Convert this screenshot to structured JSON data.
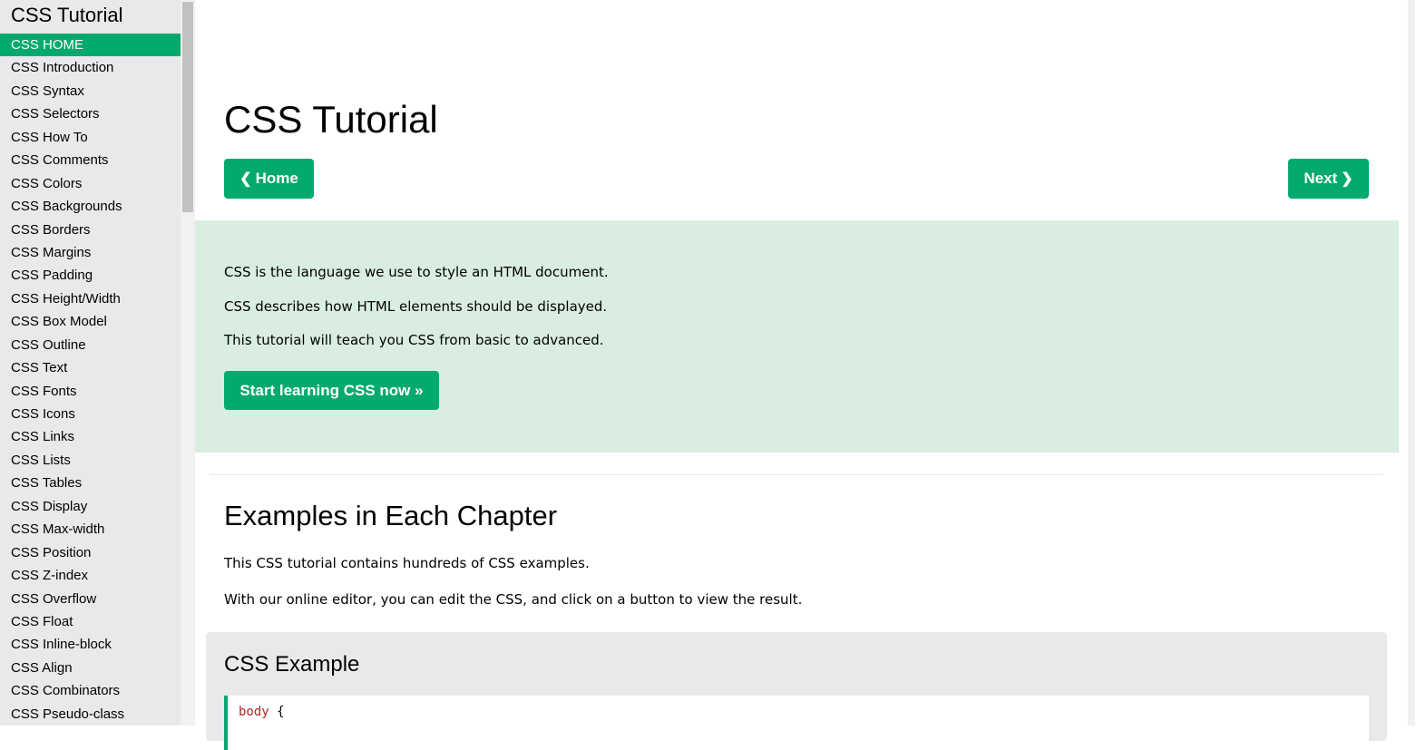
{
  "sidebar": {
    "title": "CSS Tutorial",
    "items": [
      {
        "label": "CSS HOME",
        "active": true
      },
      {
        "label": "CSS Introduction"
      },
      {
        "label": "CSS Syntax"
      },
      {
        "label": "CSS Selectors"
      },
      {
        "label": "CSS How To"
      },
      {
        "label": "CSS Comments"
      },
      {
        "label": "CSS Colors"
      },
      {
        "label": "CSS Backgrounds"
      },
      {
        "label": "CSS Borders"
      },
      {
        "label": "CSS Margins"
      },
      {
        "label": "CSS Padding"
      },
      {
        "label": "CSS Height/Width"
      },
      {
        "label": "CSS Box Model"
      },
      {
        "label": "CSS Outline"
      },
      {
        "label": "CSS Text"
      },
      {
        "label": "CSS Fonts"
      },
      {
        "label": "CSS Icons"
      },
      {
        "label": "CSS Links"
      },
      {
        "label": "CSS Lists"
      },
      {
        "label": "CSS Tables"
      },
      {
        "label": "CSS Display"
      },
      {
        "label": "CSS Max-width"
      },
      {
        "label": "CSS Position"
      },
      {
        "label": "CSS Z-index"
      },
      {
        "label": "CSS Overflow"
      },
      {
        "label": "CSS Float"
      },
      {
        "label": "CSS Inline-block"
      },
      {
        "label": "CSS Align"
      },
      {
        "label": "CSS Combinators"
      },
      {
        "label": "CSS Pseudo-class"
      }
    ]
  },
  "main": {
    "title": "CSS Tutorial",
    "nav": {
      "home_label": "Home",
      "next_label": "Next"
    },
    "intro": {
      "lines": [
        "CSS is the language we use to style an HTML document.",
        "CSS describes how HTML elements should be displayed.",
        "This tutorial will teach you CSS from basic to advanced."
      ],
      "cta_label": "Start learning CSS now »"
    },
    "examples_section": {
      "title": "Examples in Each Chapter",
      "paragraphs": [
        "This CSS tutorial contains hundreds of CSS examples.",
        "With our online editor, you can edit the CSS, and click on a button to view the result."
      ]
    },
    "example_box": {
      "title": "CSS Example",
      "code_selector": "body",
      "code_brace": "{"
    }
  },
  "colors": {
    "accent": "#04aa6d",
    "sidebar_bg": "#e7e9eb",
    "intro_bg": "#d9eee1",
    "code_selector": "#a52a2a"
  }
}
